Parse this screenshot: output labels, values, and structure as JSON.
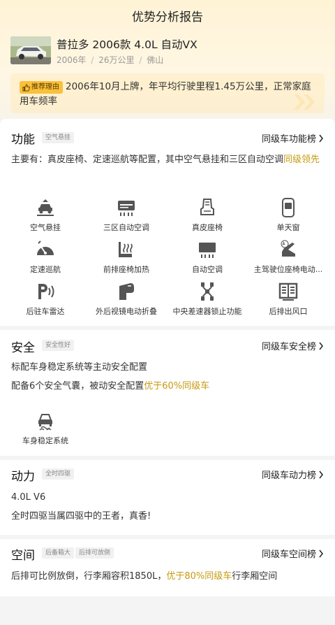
{
  "header": {
    "title": "优势分析报告"
  },
  "car": {
    "name": "普拉多 2006款 4.0L 自动VX",
    "year": "2006年",
    "mileage": "26万公里",
    "city": "佛山",
    "sep": "/"
  },
  "reason": {
    "tag": "推荐理由",
    "text": "2006年10月上牌，年平均行驶里程1.45万公里，正常家庭用车频率"
  },
  "function": {
    "title": "功能",
    "tag": "空气悬挂",
    "link": "同级车功能榜",
    "desc_pre": "主要有：真皮座椅、定速巡航等配置，其中空气悬挂和三区自动空调",
    "desc_hl": "同级领先",
    "features": [
      {
        "label": "空气悬挂",
        "icon": "air-suspension-icon"
      },
      {
        "label": "三区自动空调",
        "icon": "three-zone-ac-icon"
      },
      {
        "label": "真皮座椅",
        "icon": "leather-seat-icon"
      },
      {
        "label": "单天窗",
        "icon": "sunroof-icon"
      },
      {
        "label": "定速巡航",
        "icon": "cruise-control-icon"
      },
      {
        "label": "前排座椅加热",
        "icon": "seat-heating-icon"
      },
      {
        "label": "自动空调",
        "icon": "auto-ac-icon"
      },
      {
        "label": "主驾驶位座椅电动...",
        "icon": "power-seat-icon"
      },
      {
        "label": "后驻车雷达",
        "icon": "parking-radar-icon"
      },
      {
        "label": "外后视镜电动折叠",
        "icon": "mirror-fold-icon"
      },
      {
        "label": "中央差速器锁止功能",
        "icon": "diff-lock-icon"
      },
      {
        "label": "后排出风口",
        "icon": "rear-vent-icon"
      }
    ]
  },
  "safety": {
    "title": "安全",
    "tag": "安全性好",
    "link": "同级车安全榜",
    "line1": "标配车身稳定系统等主动安全配置",
    "line2_pre": "配备6个安全气囊，被动安全配置",
    "line2_hl": "优于60%同级车",
    "features": [
      {
        "label": "车身稳定系统",
        "icon": "stability-control-icon"
      }
    ]
  },
  "power": {
    "title": "动力",
    "tag": "全时四驱",
    "link": "同级车动力榜",
    "engine": "4.0L V6",
    "desc": "全时四驱当属四驱中的王者，真香!"
  },
  "space": {
    "title": "空间",
    "tags": [
      "后备箱大",
      "后排可放倒"
    ],
    "link": "同级车空间榜",
    "desc_pre": "后排可比例放倒，行李厢容积1850L，",
    "desc_hl": "优于80%同级车",
    "desc_post": "行李厢空间"
  },
  "colors": {
    "accent": "#c69a10",
    "tag_bg": "#f9c03a",
    "hero_bg": "#fff3d6"
  }
}
